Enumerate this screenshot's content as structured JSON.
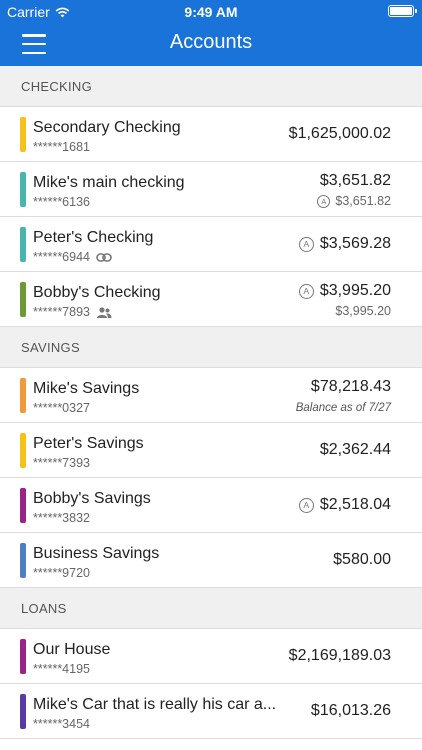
{
  "status": {
    "carrier": "Carrier",
    "time": "9:49 AM"
  },
  "nav": {
    "title": "Accounts"
  },
  "sections": {
    "checking": {
      "title": "CHECKING",
      "accounts": [
        {
          "name": "Secondary Checking",
          "number": "******1681",
          "amount": "$1,625,000.02",
          "color": "#f6c21a"
        },
        {
          "name": "Mike's main checking",
          "number": "******6136",
          "amount": "$3,651.82",
          "sub_amount": "$3,651.82",
          "badge": "A",
          "color": "#4ab5ad"
        },
        {
          "name": "Peter's Checking",
          "number": "******6944",
          "amount": "$3,569.28",
          "badge": "A",
          "color": "#4ab5ad",
          "icon": "link-icon"
        },
        {
          "name": "Bobby's Checking",
          "number": "******7893",
          "amount": "$3,995.20",
          "sub_amount": "$3,995.20",
          "badge": "A",
          "color": "#6d9a37",
          "icon": "people-icon"
        }
      ]
    },
    "savings": {
      "title": "SAVINGS",
      "accounts": [
        {
          "name": "Mike's Savings",
          "number": "******0327",
          "amount": "$78,218.43",
          "note": "Balance as of 7/27",
          "color": "#f29a3b"
        },
        {
          "name": "Peter's Savings",
          "number": "******7393",
          "amount": "$2,362.44",
          "color": "#f6c21a"
        },
        {
          "name": "Bobby's Savings",
          "number": "******3832",
          "amount": "$2,518.04",
          "badge": "A",
          "color": "#9b2383"
        },
        {
          "name": "Business Savings",
          "number": "******9720",
          "amount": "$580.00",
          "color": "#4d7fc4"
        }
      ]
    },
    "loans": {
      "title": "LOANS",
      "accounts": [
        {
          "name": "Our House",
          "number": "******4195",
          "amount": "$2,169,189.03",
          "color": "#9b2383"
        },
        {
          "name": "Mike's Car that is really his car a...",
          "number": "******3454",
          "amount": "$16,013.26",
          "color": "#5b3aa8"
        }
      ]
    }
  }
}
